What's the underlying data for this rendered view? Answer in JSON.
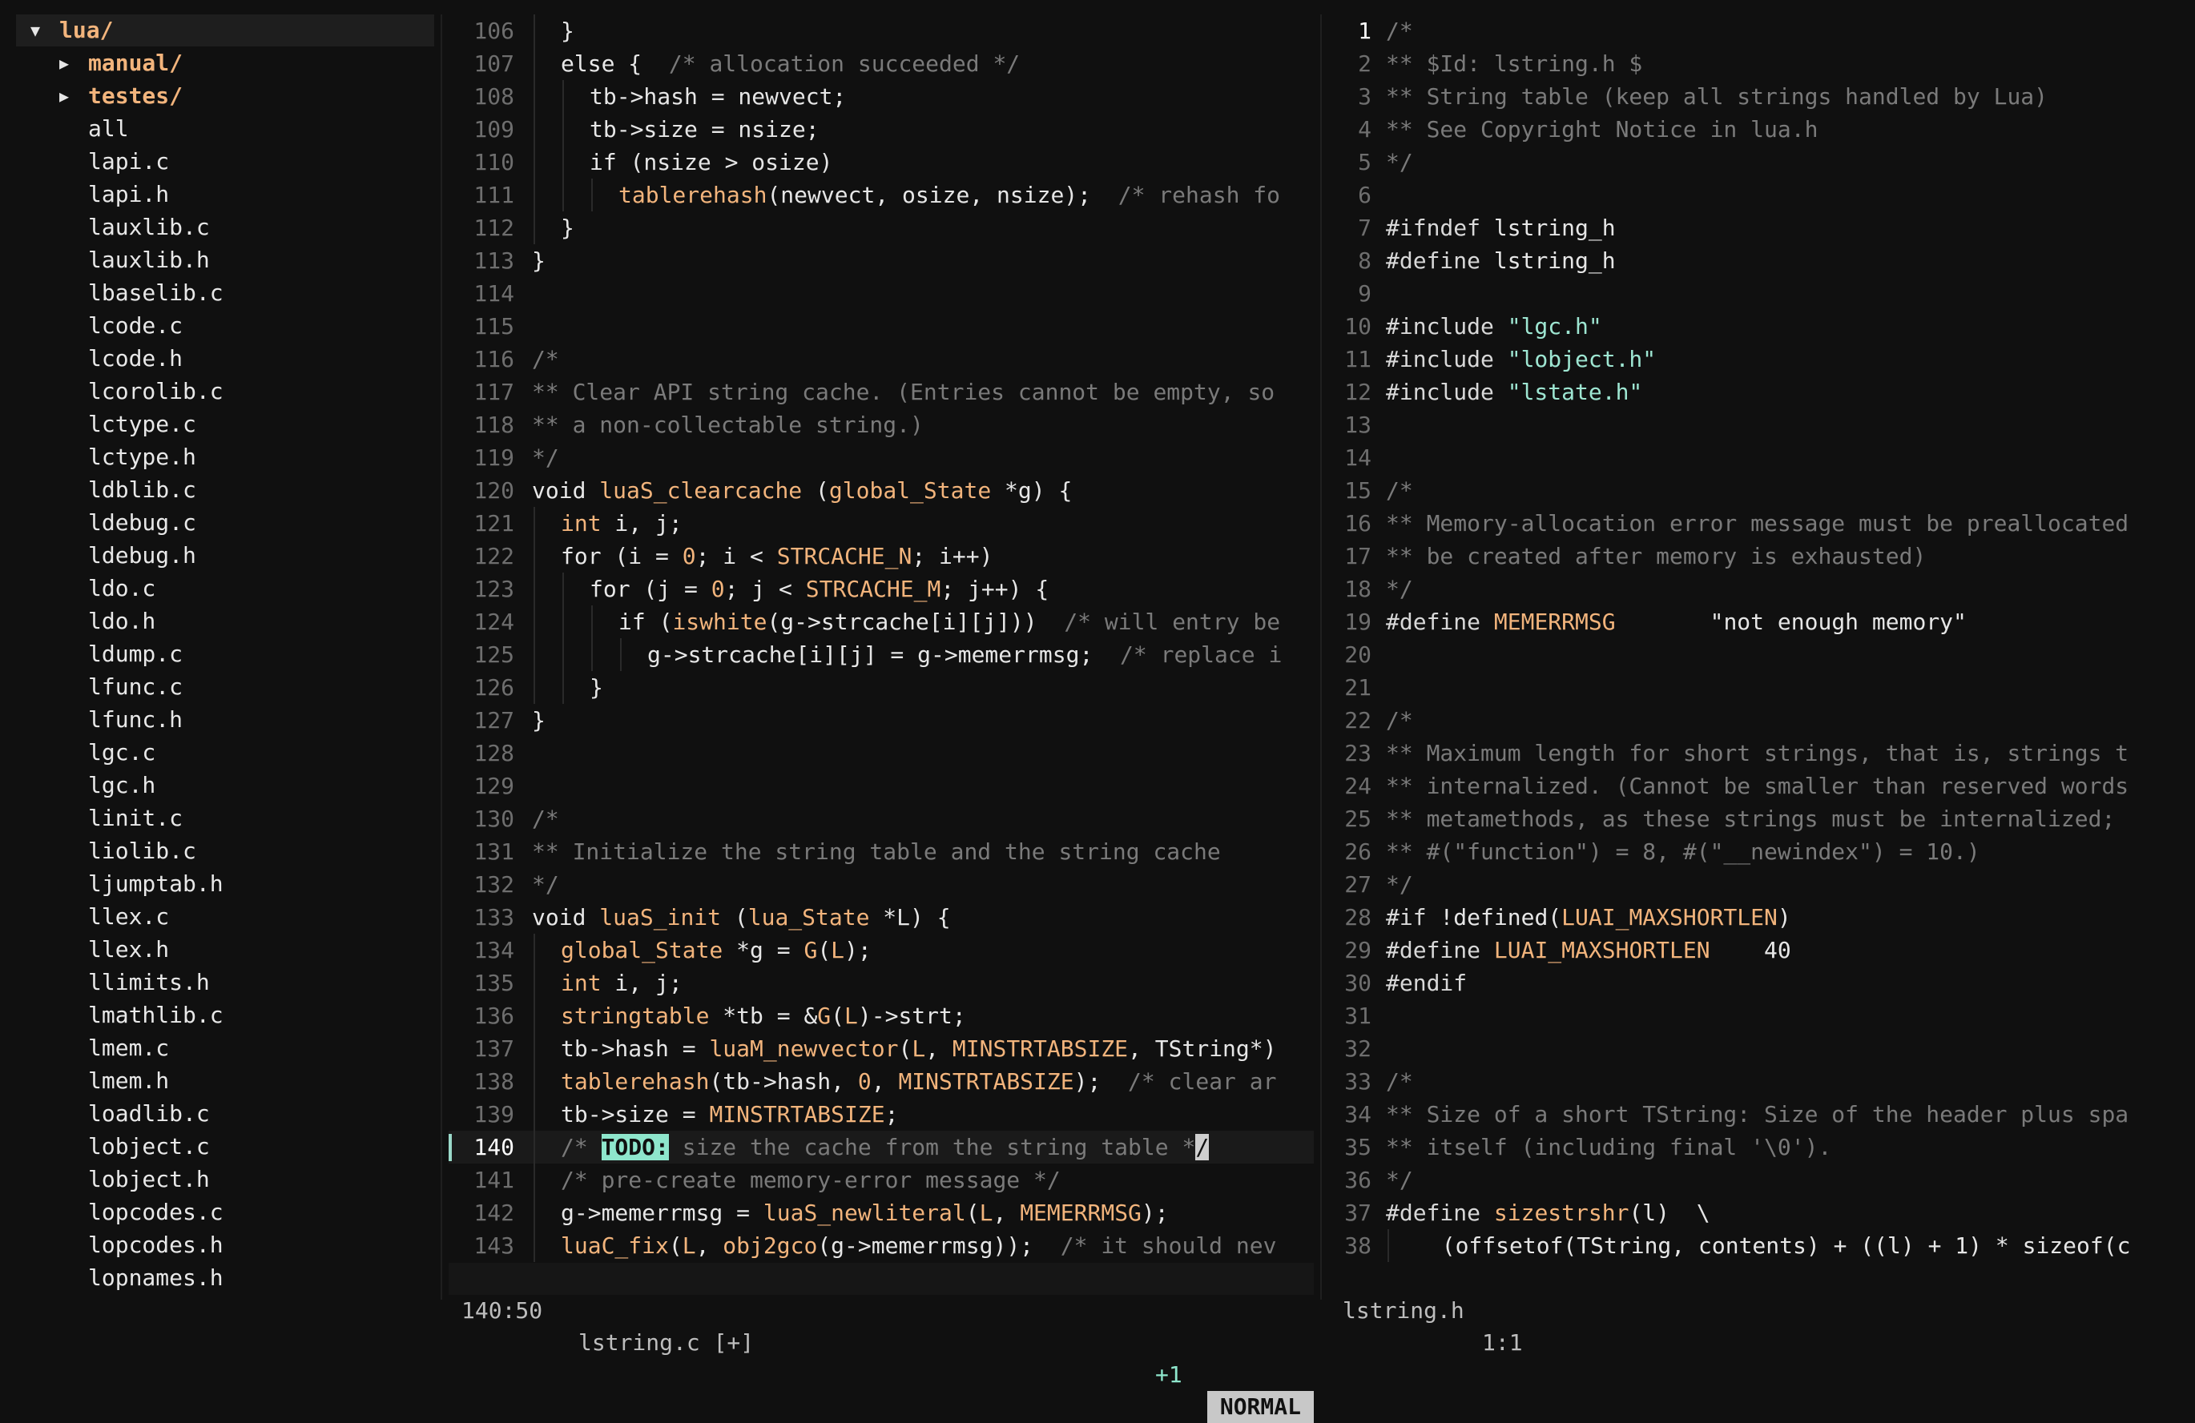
{
  "file_tree": {
    "root": {
      "name": "lua/",
      "icon": "chevron-down-icon"
    },
    "folders": [
      {
        "name": "manual/",
        "icon": "chevron-right-icon"
      },
      {
        "name": "testes/",
        "icon": "chevron-right-icon"
      }
    ],
    "files": [
      "all",
      "lapi.c",
      "lapi.h",
      "lauxlib.c",
      "lauxlib.h",
      "lbaselib.c",
      "lcode.c",
      "lcode.h",
      "lcorolib.c",
      "lctype.c",
      "lctype.h",
      "ldblib.c",
      "ldebug.c",
      "ldebug.h",
      "ldo.c",
      "ldo.h",
      "ldump.c",
      "lfunc.c",
      "lfunc.h",
      "lgc.c",
      "lgc.h",
      "linit.c",
      "liolib.c",
      "ljumptab.h",
      "llex.c",
      "llex.h",
      "llimits.h",
      "lmathlib.c",
      "lmem.c",
      "lmem.h",
      "loadlib.c",
      "lobject.c",
      "lobject.h",
      "lopcodes.c",
      "lopcodes.h",
      "lopnames.h"
    ]
  },
  "left_editor": {
    "file": "lstring.c",
    "current_line": 140,
    "lines": [
      {
        "n": 106,
        "i": 1,
        "t": [
          [
            "c-op",
            "}"
          ]
        ]
      },
      {
        "n": 107,
        "i": 1,
        "t": [
          [
            "c-kw",
            "else"
          ],
          [
            "c-op",
            " {  "
          ],
          [
            "c-cm",
            "/* allocation succeeded */"
          ]
        ]
      },
      {
        "n": 108,
        "i": 2,
        "t": [
          [
            "c-op",
            "tb->hash = newvect;"
          ]
        ]
      },
      {
        "n": 109,
        "i": 2,
        "t": [
          [
            "c-op",
            "tb->size = nsize;"
          ]
        ]
      },
      {
        "n": 110,
        "i": 2,
        "t": [
          [
            "c-kw",
            "if"
          ],
          [
            "c-op",
            " (nsize > osize)"
          ]
        ]
      },
      {
        "n": 111,
        "i": 3,
        "t": [
          [
            "c-fn",
            "tablerehash"
          ],
          [
            "c-op",
            "(newvect, osize, nsize);  "
          ],
          [
            "c-cm",
            "/* rehash fo"
          ]
        ]
      },
      {
        "n": 112,
        "i": 1,
        "t": [
          [
            "c-op",
            "}"
          ]
        ]
      },
      {
        "n": 113,
        "i": 0,
        "t": [
          [
            "c-op",
            "}"
          ]
        ]
      },
      {
        "n": 114,
        "i": 0,
        "t": []
      },
      {
        "n": 115,
        "i": 0,
        "t": []
      },
      {
        "n": 116,
        "i": 0,
        "t": [
          [
            "c-cm",
            "/*"
          ]
        ]
      },
      {
        "n": 117,
        "i": 0,
        "t": [
          [
            "c-cm",
            "** Clear API string cache. (Entries cannot be empty, so"
          ]
        ]
      },
      {
        "n": 118,
        "i": 0,
        "t": [
          [
            "c-cm",
            "** a non-collectable string.)"
          ]
        ]
      },
      {
        "n": 119,
        "i": 0,
        "t": [
          [
            "c-cm",
            "*/"
          ]
        ]
      },
      {
        "n": 120,
        "i": 0,
        "t": [
          [
            "c-kw",
            "void"
          ],
          [
            "c-op",
            " "
          ],
          [
            "c-fn",
            "luaS_clearcache"
          ],
          [
            "c-op",
            " ("
          ],
          [
            "c-ty",
            "global_State"
          ],
          [
            "c-op",
            " *g) {"
          ]
        ]
      },
      {
        "n": 121,
        "i": 1,
        "t": [
          [
            "c-ty",
            "int"
          ],
          [
            "c-op",
            " i, j;"
          ]
        ]
      },
      {
        "n": 122,
        "i": 1,
        "t": [
          [
            "c-kw",
            "for"
          ],
          [
            "c-op",
            " (i = "
          ],
          [
            "c-num",
            "0"
          ],
          [
            "c-op",
            "; i < "
          ],
          [
            "c-mac",
            "STRCACHE_N"
          ],
          [
            "c-op",
            "; i++)"
          ]
        ]
      },
      {
        "n": 123,
        "i": 2,
        "t": [
          [
            "c-kw",
            "for"
          ],
          [
            "c-op",
            " (j = "
          ],
          [
            "c-num",
            "0"
          ],
          [
            "c-op",
            "; j < "
          ],
          [
            "c-mac",
            "STRCACHE_M"
          ],
          [
            "c-op",
            "; j++) {"
          ]
        ]
      },
      {
        "n": 124,
        "i": 3,
        "t": [
          [
            "c-kw",
            "if"
          ],
          [
            "c-op",
            " ("
          ],
          [
            "c-fn",
            "iswhite"
          ],
          [
            "c-op",
            "(g->strcache[i][j]))  "
          ],
          [
            "c-cm",
            "/* will entry be"
          ]
        ]
      },
      {
        "n": 125,
        "i": 4,
        "t": [
          [
            "c-op",
            "g->strcache[i][j] = g->memerrmsg;  "
          ],
          [
            "c-cm",
            "/* replace i"
          ]
        ]
      },
      {
        "n": 126,
        "i": 2,
        "t": [
          [
            "c-op",
            "}"
          ]
        ]
      },
      {
        "n": 127,
        "i": 0,
        "t": [
          [
            "c-op",
            "}"
          ]
        ]
      },
      {
        "n": 128,
        "i": 0,
        "t": []
      },
      {
        "n": 129,
        "i": 0,
        "t": []
      },
      {
        "n": 130,
        "i": 0,
        "t": [
          [
            "c-cm",
            "/*"
          ]
        ]
      },
      {
        "n": 131,
        "i": 0,
        "t": [
          [
            "c-cm",
            "** Initialize the string table and the string cache"
          ]
        ]
      },
      {
        "n": 132,
        "i": 0,
        "t": [
          [
            "c-cm",
            "*/"
          ]
        ]
      },
      {
        "n": 133,
        "i": 0,
        "t": [
          [
            "c-kw",
            "void"
          ],
          [
            "c-op",
            " "
          ],
          [
            "c-fn",
            "luaS_init"
          ],
          [
            "c-op",
            " ("
          ],
          [
            "c-ty",
            "lua_State"
          ],
          [
            "c-op",
            " *L) {"
          ]
        ]
      },
      {
        "n": 134,
        "i": 1,
        "t": [
          [
            "c-ty",
            "global_State"
          ],
          [
            "c-op",
            " *g = "
          ],
          [
            "c-mac",
            "G"
          ],
          [
            "c-op",
            "("
          ],
          [
            "c-mac",
            "L"
          ],
          [
            "c-op",
            ");"
          ]
        ]
      },
      {
        "n": 135,
        "i": 1,
        "t": [
          [
            "c-ty",
            "int"
          ],
          [
            "c-op",
            " i, j;"
          ]
        ]
      },
      {
        "n": 136,
        "i": 1,
        "t": [
          [
            "c-ty",
            "stringtable"
          ],
          [
            "c-op",
            " *tb = &"
          ],
          [
            "c-mac",
            "G"
          ],
          [
            "c-op",
            "("
          ],
          [
            "c-mac",
            "L"
          ],
          [
            "c-op",
            ")->strt;"
          ]
        ]
      },
      {
        "n": 137,
        "i": 1,
        "t": [
          [
            "c-op",
            "tb->hash = "
          ],
          [
            "c-fn",
            "luaM_newvector"
          ],
          [
            "c-op",
            "("
          ],
          [
            "c-mac",
            "L"
          ],
          [
            "c-op",
            ", "
          ],
          [
            "c-mac",
            "MINSTRTABSIZE"
          ],
          [
            "c-op",
            ", TString*)"
          ]
        ]
      },
      {
        "n": 138,
        "i": 1,
        "t": [
          [
            "c-fn",
            "tablerehash"
          ],
          [
            "c-op",
            "(tb->hash, "
          ],
          [
            "c-num",
            "0"
          ],
          [
            "c-op",
            ", "
          ],
          [
            "c-mac",
            "MINSTRTABSIZE"
          ],
          [
            "c-op",
            ");  "
          ],
          [
            "c-cm",
            "/* clear ar"
          ]
        ]
      },
      {
        "n": 139,
        "i": 1,
        "t": [
          [
            "c-op",
            "tb->size = "
          ],
          [
            "c-mac",
            "MINSTRTABSIZE"
          ],
          [
            "c-op",
            ";"
          ]
        ]
      },
      {
        "n": 140,
        "i": 1,
        "t": [
          [
            "c-cm",
            "/* "
          ],
          [
            "todo",
            "TODO:"
          ],
          [
            "c-cm",
            " size the cache from the string table *"
          ],
          [
            "cursor",
            "/"
          ]
        ]
      },
      {
        "n": 141,
        "i": 1,
        "t": [
          [
            "c-cm",
            "/* pre-create memory-error message */"
          ]
        ]
      },
      {
        "n": 142,
        "i": 1,
        "t": [
          [
            "c-op",
            "g->memerrmsg = "
          ],
          [
            "c-fn",
            "luaS_newliteral"
          ],
          [
            "c-op",
            "("
          ],
          [
            "c-mac",
            "L"
          ],
          [
            "c-op",
            ", "
          ],
          [
            "c-mac",
            "MEMERRMSG"
          ],
          [
            "c-op",
            ");"
          ]
        ]
      },
      {
        "n": 143,
        "i": 1,
        "t": [
          [
            "c-fn",
            "luaC_fix"
          ],
          [
            "c-op",
            "("
          ],
          [
            "c-mac",
            "L"
          ],
          [
            "c-op",
            ", "
          ],
          [
            "c-fn",
            "obj2gco"
          ],
          [
            "c-op",
            "(g->memerrmsg));  "
          ],
          [
            "c-cm",
            "/* it should nev"
          ]
        ]
      }
    ],
    "status": {
      "position": "140:50",
      "file_label": "lstring.c [+]",
      "diff": "+1",
      "mode": "NORMAL"
    }
  },
  "right_editor": {
    "file": "lstring.h",
    "current_line": 1,
    "lines": [
      {
        "n": 1,
        "i": 0,
        "t": [
          [
            "c-cm",
            "/*"
          ]
        ]
      },
      {
        "n": 2,
        "i": 0,
        "t": [
          [
            "c-cm",
            "** $Id: lstring.h $"
          ]
        ]
      },
      {
        "n": 3,
        "i": 0,
        "t": [
          [
            "c-cm",
            "** String table (keep all strings handled by Lua)"
          ]
        ]
      },
      {
        "n": 4,
        "i": 0,
        "t": [
          [
            "c-cm",
            "** See Copyright Notice in lua.h"
          ]
        ]
      },
      {
        "n": 5,
        "i": 0,
        "t": [
          [
            "c-cm",
            "*/"
          ]
        ]
      },
      {
        "n": 6,
        "i": 0,
        "t": []
      },
      {
        "n": 7,
        "i": 0,
        "t": [
          [
            "c-pp",
            "#ifndef"
          ],
          [
            "c-op",
            " lstring_h"
          ]
        ]
      },
      {
        "n": 8,
        "i": 0,
        "t": [
          [
            "c-pp",
            "#define"
          ],
          [
            "c-op",
            " lstring_h"
          ]
        ]
      },
      {
        "n": 9,
        "i": 0,
        "t": []
      },
      {
        "n": 10,
        "i": 0,
        "t": [
          [
            "c-pp",
            "#include"
          ],
          [
            "c-op",
            " "
          ],
          [
            "c-str",
            "\"lgc.h\""
          ]
        ]
      },
      {
        "n": 11,
        "i": 0,
        "t": [
          [
            "c-pp",
            "#include"
          ],
          [
            "c-op",
            " "
          ],
          [
            "c-str",
            "\"lobject.h\""
          ]
        ]
      },
      {
        "n": 12,
        "i": 0,
        "t": [
          [
            "c-pp",
            "#include"
          ],
          [
            "c-op",
            " "
          ],
          [
            "c-str",
            "\"lstate.h\""
          ]
        ]
      },
      {
        "n": 13,
        "i": 0,
        "t": []
      },
      {
        "n": 14,
        "i": 0,
        "t": []
      },
      {
        "n": 15,
        "i": 0,
        "t": [
          [
            "c-cm",
            "/*"
          ]
        ]
      },
      {
        "n": 16,
        "i": 0,
        "t": [
          [
            "c-cm",
            "** Memory-allocation error message must be preallocated"
          ]
        ]
      },
      {
        "n": 17,
        "i": 0,
        "t": [
          [
            "c-cm",
            "** be created after memory is exhausted)"
          ]
        ]
      },
      {
        "n": 18,
        "i": 0,
        "t": [
          [
            "c-cm",
            "*/"
          ]
        ]
      },
      {
        "n": 19,
        "i": 0,
        "t": [
          [
            "c-pp",
            "#define"
          ],
          [
            "c-op",
            " "
          ],
          [
            "c-mac",
            "MEMERRMSG"
          ],
          [
            "c-op",
            "       \"not enough memory\""
          ]
        ]
      },
      {
        "n": 20,
        "i": 0,
        "t": []
      },
      {
        "n": 21,
        "i": 0,
        "t": []
      },
      {
        "n": 22,
        "i": 0,
        "t": [
          [
            "c-cm",
            "/*"
          ]
        ]
      },
      {
        "n": 23,
        "i": 0,
        "t": [
          [
            "c-cm",
            "** Maximum length for short strings, that is, strings t"
          ]
        ]
      },
      {
        "n": 24,
        "i": 0,
        "t": [
          [
            "c-cm",
            "** internalized. (Cannot be smaller than reserved words"
          ]
        ]
      },
      {
        "n": 25,
        "i": 0,
        "t": [
          [
            "c-cm",
            "** metamethods, as these strings must be internalized;"
          ]
        ]
      },
      {
        "n": 26,
        "i": 0,
        "t": [
          [
            "c-cm",
            "** #(\"function\") = 8, #(\"__newindex\") = 10.)"
          ]
        ]
      },
      {
        "n": 27,
        "i": 0,
        "t": [
          [
            "c-cm",
            "*/"
          ]
        ]
      },
      {
        "n": 28,
        "i": 0,
        "t": [
          [
            "c-pp",
            "#if"
          ],
          [
            "c-op",
            " !defined("
          ],
          [
            "c-mac",
            "LUAI_MAXSHORTLEN"
          ],
          [
            "c-op",
            ")"
          ]
        ]
      },
      {
        "n": 29,
        "i": 0,
        "t": [
          [
            "c-pp",
            "#define"
          ],
          [
            "c-op",
            " "
          ],
          [
            "c-mac",
            "LUAI_MAXSHORTLEN"
          ],
          [
            "c-op",
            "    40"
          ]
        ]
      },
      {
        "n": 30,
        "i": 0,
        "t": [
          [
            "c-pp",
            "#endif"
          ]
        ]
      },
      {
        "n": 31,
        "i": 0,
        "t": []
      },
      {
        "n": 32,
        "i": 0,
        "t": []
      },
      {
        "n": 33,
        "i": 0,
        "t": [
          [
            "c-cm",
            "/*"
          ]
        ]
      },
      {
        "n": 34,
        "i": 0,
        "t": [
          [
            "c-cm",
            "** Size of a short TString: Size of the header plus spa"
          ]
        ]
      },
      {
        "n": 35,
        "i": 0,
        "t": [
          [
            "c-cm",
            "** itself (including final '\\0')."
          ]
        ]
      },
      {
        "n": 36,
        "i": 0,
        "t": [
          [
            "c-cm",
            "*/"
          ]
        ]
      },
      {
        "n": 37,
        "i": 0,
        "t": [
          [
            "c-pp",
            "#define"
          ],
          [
            "c-op",
            " "
          ],
          [
            "c-fn",
            "sizestrshr"
          ],
          [
            "c-op",
            "(l)  \\"
          ]
        ]
      },
      {
        "n": 38,
        "i": 1,
        "t": [
          [
            "c-op",
            "  (offsetof(TString, contents) + ((l) + 1) * sizeof(c"
          ]
        ]
      }
    ],
    "status": {
      "file_label": "lstring.h",
      "position": "1:1"
    }
  }
}
